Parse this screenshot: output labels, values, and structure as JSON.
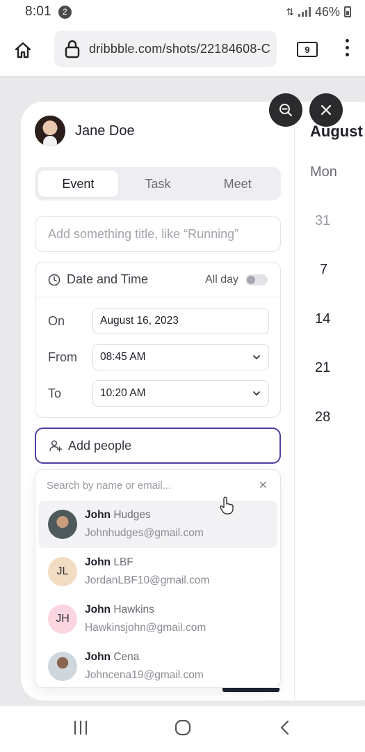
{
  "status_bar": {
    "time": "8:01",
    "notification_count": "2",
    "battery": "46%"
  },
  "browser": {
    "url": "dribbble.com/shots/22184608-C",
    "tab_count": "9"
  },
  "app": {
    "user": {
      "name": "Jane Doe"
    },
    "tabs": [
      "Event",
      "Task",
      "Meet"
    ],
    "active_tab": "Event",
    "title_placeholder": "Add something title, like “Running”",
    "date_time": {
      "label": "Date and Time",
      "all_day_label": "All day",
      "all_day_on": false,
      "on_label": "On",
      "on_value": "August 16, 2023",
      "from_label": "From",
      "from_value": "08:45 AM",
      "to_label": "To",
      "to_value": "10:20 AM"
    },
    "add_people_label": "Add people",
    "people_search_placeholder": "Search by name or email...",
    "people": [
      {
        "first": "John",
        "last": "Hudges",
        "email": "Johnhudges@gmail.com",
        "initials": "",
        "highlighted": true
      },
      {
        "first": "John",
        "last": "LBF",
        "email": "JordanLBF10@gmail.com",
        "initials": "JL",
        "highlighted": false
      },
      {
        "first": "John",
        "last": "Hawkins",
        "email": "Hawkinsjohn@gmail.com",
        "initials": "JH",
        "highlighted": false
      },
      {
        "first": "John",
        "last": "Cena",
        "email": "Johncena19@gmail.com",
        "initials": "",
        "highlighted": false
      }
    ],
    "calendar": {
      "month": "August",
      "weekday": "Mon",
      "days": [
        "31",
        "7",
        "14",
        "21",
        "28"
      ]
    }
  },
  "colors": {
    "accent_border": "#4b3ea3",
    "fab_bg": "#2b2b2e",
    "initials_jl_bg": "#f2dcc2",
    "initials_jh_bg": "#fbd6e0"
  },
  "icons": {
    "home": "home-icon",
    "lock": "lock-icon",
    "menu": "more-vert-icon",
    "clock": "clock-icon",
    "add_person": "add-person-icon",
    "zoom_out": "zoom-out-icon",
    "close": "close-icon",
    "chevron": "chevron-down-icon"
  }
}
